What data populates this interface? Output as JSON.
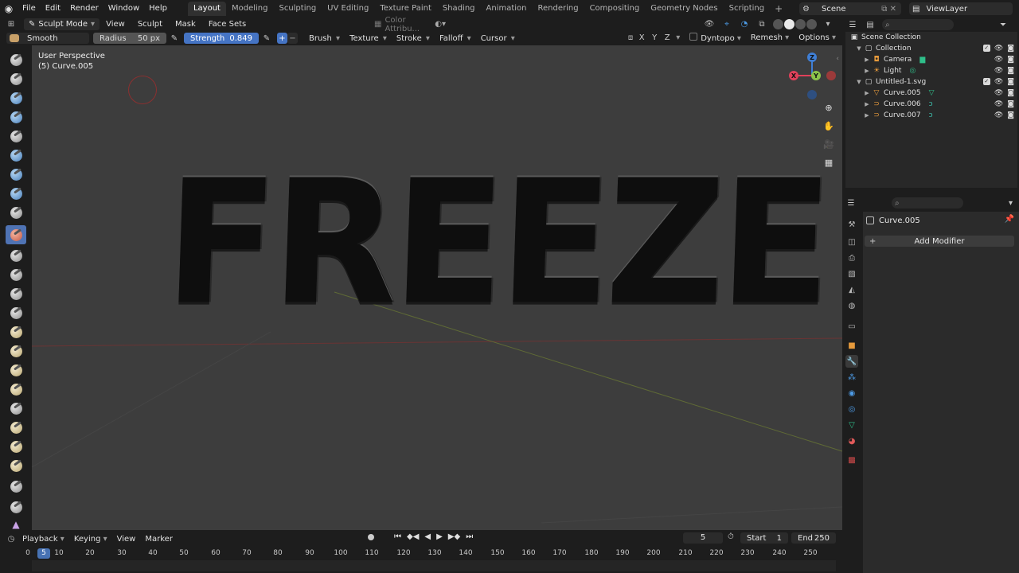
{
  "menu": {
    "items": [
      "File",
      "Edit",
      "Render",
      "Window",
      "Help"
    ],
    "workspaces": [
      "Layout",
      "Modeling",
      "Sculpting",
      "UV Editing",
      "Texture Paint",
      "Shading",
      "Animation",
      "Rendering",
      "Compositing",
      "Geometry Nodes",
      "Scripting"
    ],
    "active_workspace": "Layout",
    "scene": "Scene",
    "view_layer": "ViewLayer"
  },
  "viewport_header": {
    "mode": "Sculpt Mode",
    "menus": [
      "View",
      "Sculpt",
      "Mask",
      "Face Sets"
    ],
    "color_attribute": "Color Attribu..."
  },
  "tool_settings": {
    "brush": "Smooth",
    "radius_label": "Radius",
    "radius_value": "50 px",
    "strength_label": "Strength",
    "strength_value": "0.849",
    "menus": [
      "Brush",
      "Texture",
      "Stroke",
      "Falloff",
      "Cursor"
    ],
    "axes": [
      "X",
      "Y",
      "Z"
    ],
    "dyntopo": "Dyntopo",
    "remesh": "Remesh",
    "options": "Options"
  },
  "viewport": {
    "perspective": "User Perspective",
    "object_label": "(5) Curve.005",
    "text_3d": "FREEZE",
    "gizmo": {
      "z": "Z",
      "y": "Y",
      "x": "X"
    }
  },
  "outliner": {
    "rows": [
      {
        "name": "Scene Collection",
        "icon": "collection-icon",
        "level": 0
      },
      {
        "name": "Collection",
        "icon": "collection-icon",
        "level": 1
      },
      {
        "name": "Camera",
        "icon": "camera-icon",
        "level": 2
      },
      {
        "name": "Light",
        "icon": "light-icon",
        "level": 2
      },
      {
        "name": "Untitled-1.svg",
        "icon": "collection-icon",
        "level": 1
      },
      {
        "name": "Curve.005",
        "icon": "curve-icon",
        "level": 2
      },
      {
        "name": "Curve.006",
        "icon": "curve-icon",
        "level": 2
      },
      {
        "name": "Curve.007",
        "icon": "curve-icon",
        "level": 2
      }
    ]
  },
  "properties": {
    "object_name": "Curve.005",
    "add_modifier": "Add Modifier"
  },
  "timeline": {
    "menus": [
      "Playback",
      "Keying",
      "View",
      "Marker"
    ],
    "current_frame": "5",
    "start_label": "Start",
    "start_value": "1",
    "end_label": "End",
    "end_value": "250",
    "ruler_ticks": [
      "0",
      "10",
      "20",
      "30",
      "40",
      "50",
      "60",
      "70",
      "80",
      "90",
      "100",
      "110",
      "120",
      "130",
      "140",
      "150",
      "160",
      "170",
      "180",
      "190",
      "200",
      "210",
      "220",
      "230",
      "240",
      "250"
    ],
    "ruler_current": "5"
  },
  "colors": {
    "accent": "#4772b3",
    "x_axis": "#e0415a",
    "y_axis": "#8bc34a",
    "z_axis": "#3f7fd6"
  }
}
